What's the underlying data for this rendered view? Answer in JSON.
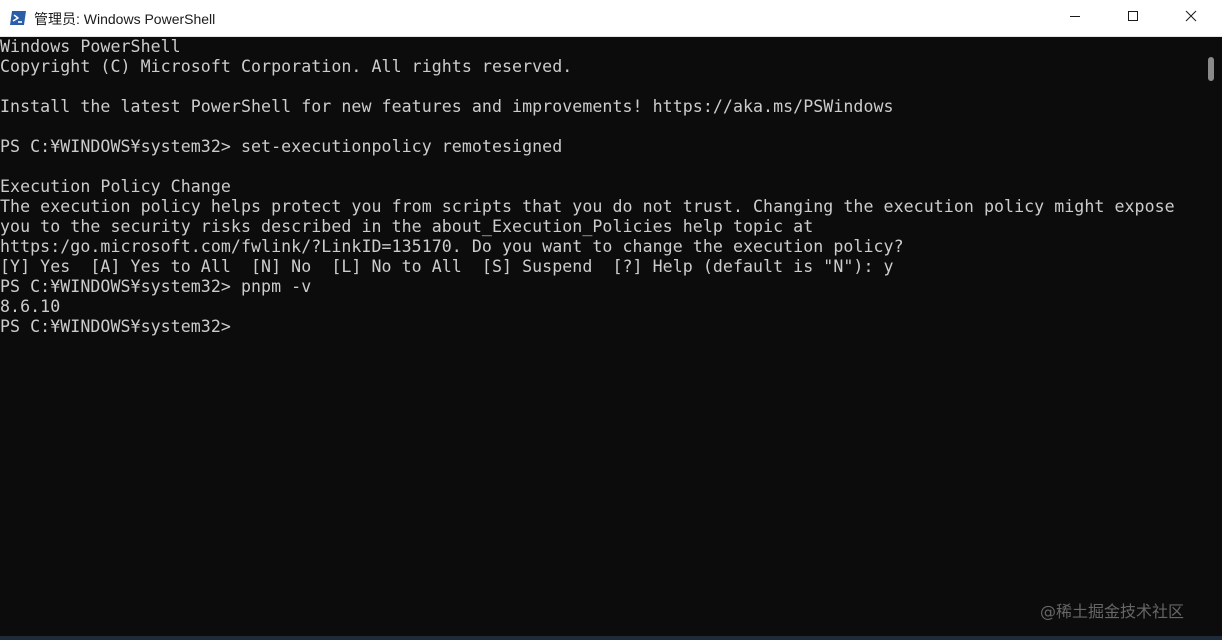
{
  "window": {
    "title": "管理员: Windows PowerShell",
    "colors": {
      "terminal_bg": "#0c0c0c",
      "terminal_fg": "#cccccc",
      "titlebar_bg": "#ffffff",
      "icon_blue": "#2a5ea8"
    },
    "controls": {
      "minimize_icon": "minimize-icon",
      "maximize_icon": "maximize-icon",
      "close_icon": "close-icon"
    }
  },
  "terminal": {
    "lines": [
      "Windows PowerShell",
      "Copyright (C) Microsoft Corporation. All rights reserved.",
      "",
      "Install the latest PowerShell for new features and improvements! https://aka.ms/PSWindows",
      "",
      "PS C:¥WINDOWS¥system32> set-executionpolicy remotesigned",
      "",
      "Execution Policy Change",
      "The execution policy helps protect you from scripts that you do not trust. Changing the execution policy might expose",
      "you to the security risks described in the about_Execution_Policies help topic at",
      "https:/go.microsoft.com/fwlink/?LinkID=135170. Do you want to change the execution policy?",
      "[Y] Yes  [A] Yes to All  [N] No  [L] No to All  [S] Suspend  [?] Help (default is \"N\"): y",
      "PS C:¥WINDOWS¥system32> pnpm -v",
      "8.6.10",
      "PS C:¥WINDOWS¥system32>"
    ]
  },
  "watermark": "@稀土掘金技术社区"
}
